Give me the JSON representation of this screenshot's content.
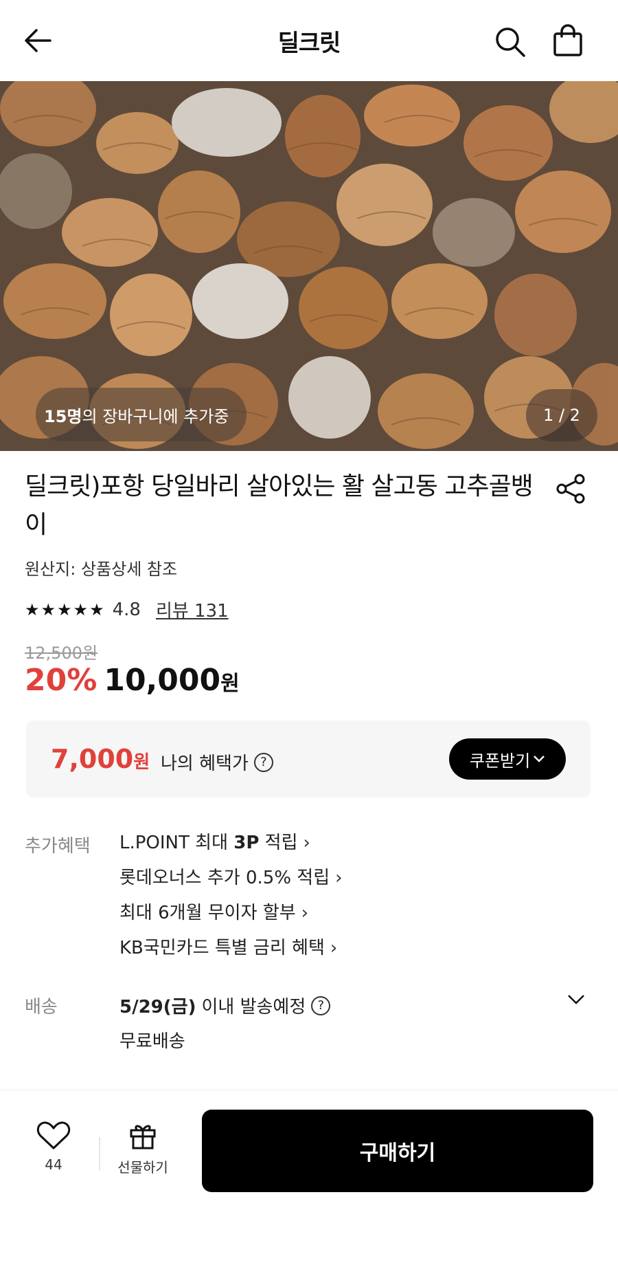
{
  "header": {
    "title": "딜크릿",
    "icons": {
      "back": "arrow-left-icon",
      "search": "search-icon",
      "cart": "shopping-bag-icon"
    }
  },
  "hero": {
    "cart_count_number": "15명",
    "cart_count_text": "의 장바구니에 추가중",
    "pager": "1 / 2"
  },
  "product": {
    "title": "딜크릿)포항 당일바리 살아있는 활 살고동 고추골뱅이",
    "origin": "원산지: 상품상세 참조",
    "stars": "★★★★★",
    "rating": "4.8",
    "review": "리뷰 131",
    "original_price": "12,500원",
    "discount": "20%",
    "price": "10,000",
    "price_unit": "원"
  },
  "benefit": {
    "price": "7,000",
    "price_unit": "원",
    "label": "나의 혜택가",
    "coupon_button": "쿠폰받기"
  },
  "extra": {
    "label": "추가혜택",
    "items": [
      {
        "pre": "L.POINT 최대 ",
        "bold": "3P",
        "post": " 적립"
      },
      {
        "pre": "롯데오너스 추가 0.5% 적립",
        "bold": "",
        "post": ""
      },
      {
        "pre": "최대 6개월 무이자 할부",
        "bold": "",
        "post": ""
      },
      {
        "pre": "KB국민카드 특별 금리 혜택",
        "bold": "",
        "post": ""
      }
    ]
  },
  "shipping": {
    "label": "배송",
    "date": "5/29(금)",
    "date_text": "이내 발송예정",
    "fee": "무료배송"
  },
  "bottom": {
    "like_count": "44",
    "gift_label": "선물하기",
    "buy_button": "구매하기"
  },
  "colors": {
    "accent_red": "#e0413b",
    "black": "#000000"
  }
}
